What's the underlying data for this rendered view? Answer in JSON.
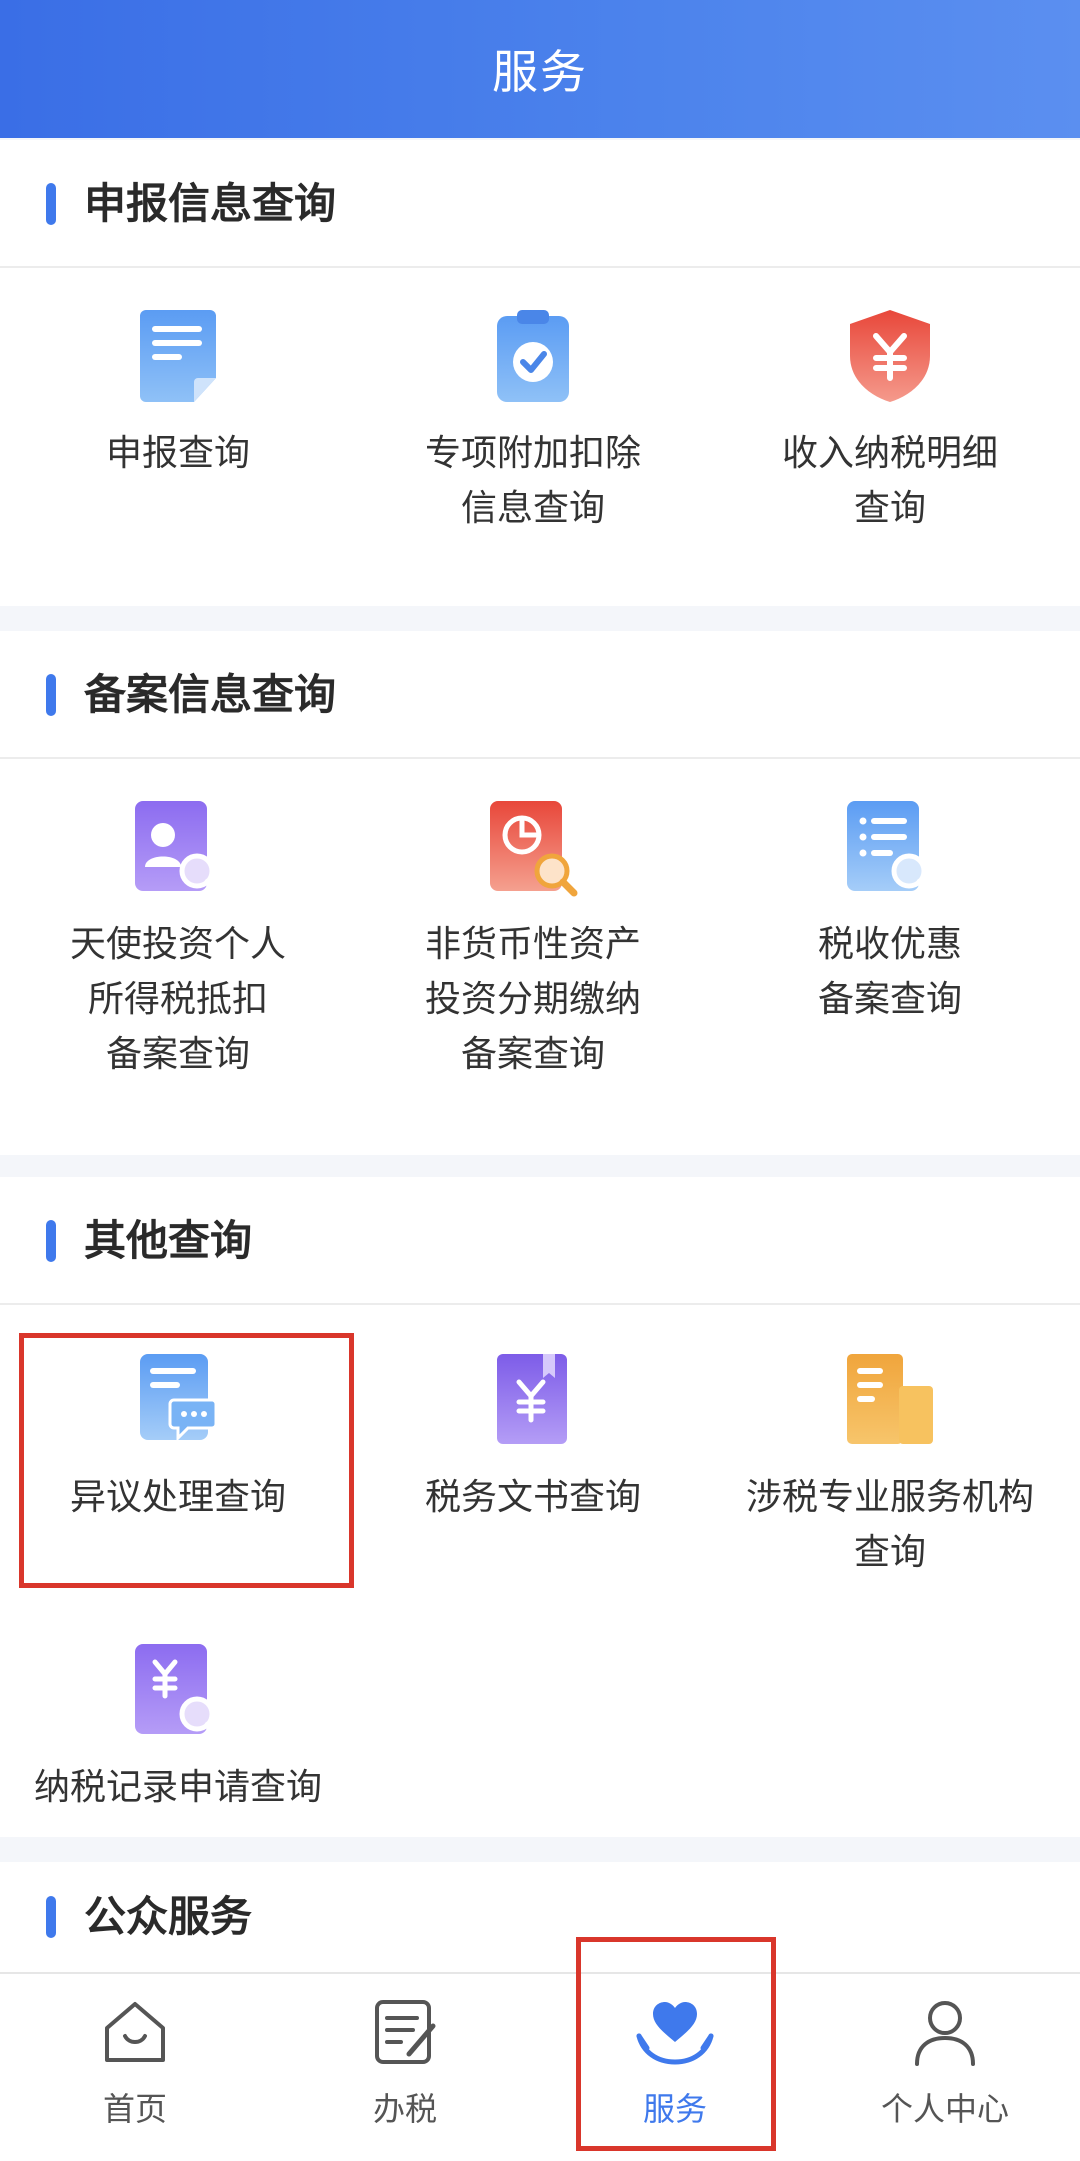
{
  "header": {
    "title": "服务"
  },
  "sections": [
    {
      "title": "申报信息查询",
      "items": [
        {
          "lines": [
            "申报查询"
          ],
          "icon": "document-icon"
        },
        {
          "lines": [
            "专项附加扣除",
            "信息查询"
          ],
          "icon": "clipboard-check-icon"
        },
        {
          "lines": [
            "收入纳税明细",
            "查询"
          ],
          "icon": "yuan-shield-icon"
        }
      ]
    },
    {
      "title": "备案信息查询",
      "items": [
        {
          "lines": [
            "天使投资个人",
            "所得税抵扣",
            "备案查询"
          ],
          "icon": "person-search-icon"
        },
        {
          "lines": [
            "非货币性资产",
            "投资分期缴纳",
            "备案查询"
          ],
          "icon": "pie-search-icon"
        },
        {
          "lines": [
            "税收优惠",
            "备案查询"
          ],
          "icon": "list-search-icon"
        }
      ]
    },
    {
      "title": "其他查询",
      "items": [
        {
          "lines": [
            "异议处理查询"
          ],
          "icon": "chat-document-icon"
        },
        {
          "lines": [
            "税务文书查询"
          ],
          "icon": "yuan-book-icon"
        },
        {
          "lines": [
            "涉税专业服务机构",
            "查询"
          ],
          "icon": "building-icon"
        },
        {
          "lines": [
            "纳税记录申请查询"
          ],
          "icon": "yuan-search-icon"
        }
      ]
    },
    {
      "title": "公众服务",
      "items": []
    }
  ],
  "tabbar": {
    "items": [
      {
        "label": "首页",
        "icon": "home-icon",
        "active": false
      },
      {
        "label": "办税",
        "icon": "edit-list-icon",
        "active": false
      },
      {
        "label": "服务",
        "icon": "heart-hands-icon",
        "active": true
      },
      {
        "label": "个人中心",
        "icon": "user-icon",
        "active": false
      }
    ]
  },
  "colors": {
    "accent": "#3f79ec",
    "highlight": "#d9362b",
    "header_start": "#3a6ee6",
    "header_end": "#5b8ff0"
  }
}
